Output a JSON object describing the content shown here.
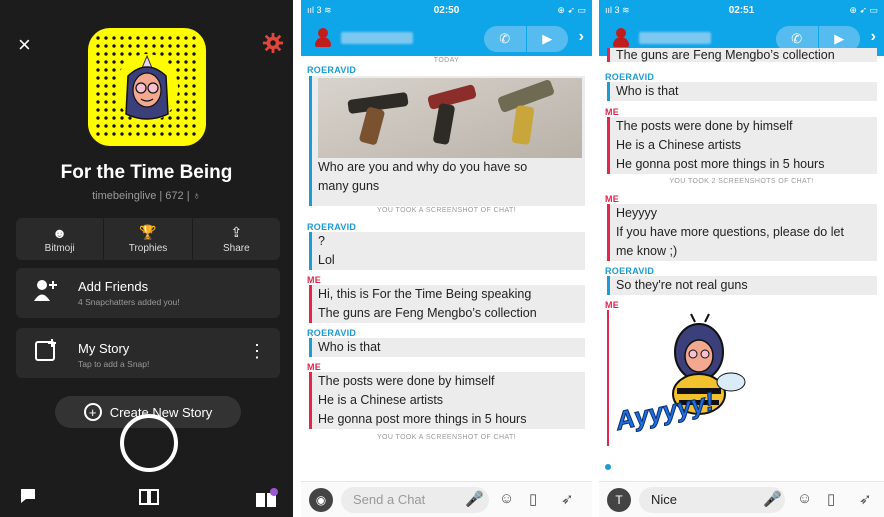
{
  "panel1": {
    "close_icon": "×",
    "display_name": "For the Time Being",
    "username_line": "timebeinglive | 672 | ♁",
    "stats": [
      {
        "icon": "☻",
        "label": "Bitmoji"
      },
      {
        "icon": "🏆",
        "label": "Trophies"
      },
      {
        "icon": "⇪",
        "label": "Share"
      }
    ],
    "add_friends": {
      "title": "Add Friends",
      "subtitle": "4 Snapchatters added you!"
    },
    "my_story": {
      "title": "My Story",
      "subtitle": "Tap to add a Snap!",
      "menu": "⋮"
    },
    "create_story": "Create New Story"
  },
  "panel2": {
    "status": {
      "left": "ııl 3 ≋",
      "time": "02:50",
      "right": "⊕ ➹ ▭"
    },
    "today": "TODAY",
    "messages": [
      {
        "sender": "ROERAVID",
        "who": "them",
        "lines": [
          "Who are you and why do you have so",
          "many guns"
        ]
      },
      {
        "note": "YOU TOOK A SCREENSHOT OF CHAT!"
      },
      {
        "sender": "ROERAVID",
        "who": "them",
        "lines": [
          "?",
          "Lol"
        ]
      },
      {
        "sender": "ME",
        "who": "me",
        "lines": [
          "Hi, this is For the Time Being speaking",
          "The guns are Feng Mengbo’s collection"
        ]
      },
      {
        "sender": "ROERAVID",
        "who": "them",
        "lines": [
          "Who is that"
        ]
      },
      {
        "sender": "ME",
        "who": "me",
        "lines": [
          "The posts were done by himself",
          "He is a Chinese artists",
          "He gonna post more things in 5 hours"
        ]
      },
      {
        "note": "YOU TOOK A SCREENSHOT OF CHAT!"
      }
    ],
    "input_placeholder": "Send a Chat"
  },
  "panel3": {
    "status": {
      "left": "ııl 3 ≋",
      "time": "02:51",
      "right": "⊕ ➹ ▭"
    },
    "messages": [
      {
        "who": "me",
        "lines": [
          "The guns are Feng Mengbo’s collection"
        ]
      },
      {
        "sender": "ROERAVID",
        "who": "them",
        "lines": [
          "Who is that"
        ]
      },
      {
        "sender": "ME",
        "who": "me",
        "lines": [
          "The posts were done by himself",
          "He is a Chinese artists",
          "He gonna post more things in 5 hours"
        ]
      },
      {
        "note": "YOU TOOK 2 SCREENSHOTS OF CHAT!"
      },
      {
        "sender": "ME",
        "who": "me",
        "lines": [
          "Heyyyy",
          "If you have more questions, please do let",
          "me know ;)"
        ]
      },
      {
        "sender": "ROERAVID",
        "who": "them",
        "lines": [
          "So they're not real guns"
        ]
      },
      {
        "sender": "ME",
        "who": "me",
        "sticker": "Ayyyyy!"
      }
    ],
    "input_value": "Nice"
  },
  "colors": {
    "snap_yellow": "#fffc00",
    "chat_blue": "#0ea5e9",
    "me_red": "#e2264d",
    "them_blue": "#1d9bd6"
  }
}
